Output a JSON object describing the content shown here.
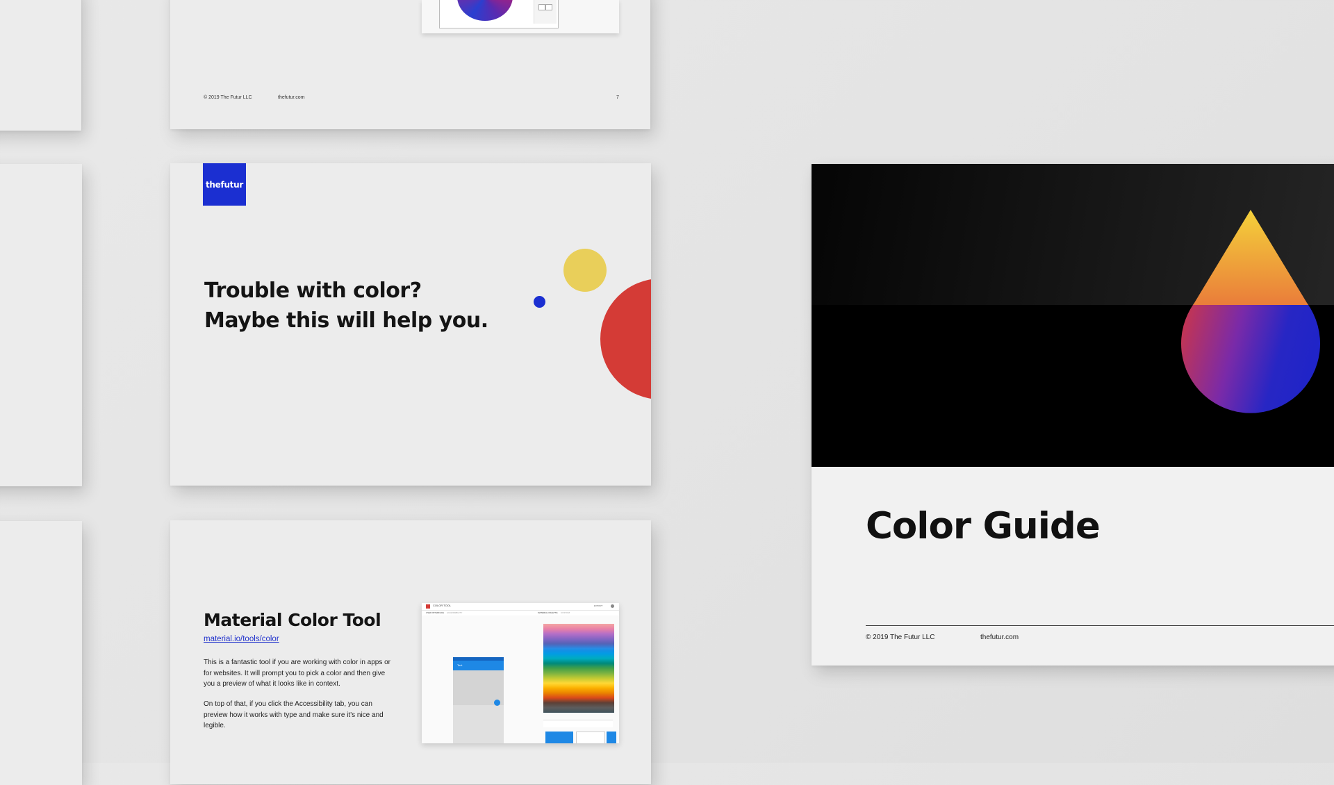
{
  "page_7": {
    "copyright": "© 2019 The Futur LLC",
    "site": "thefutur.com",
    "page_number": "7"
  },
  "trouble_page": {
    "logo_text": "thefutur",
    "headline_line1": "Trouble with color?",
    "headline_line2": "Maybe this will help you.",
    "colors": {
      "brand_blue": "#1b2fd1",
      "yellow": "#e9cf5a",
      "red": "#d43b36"
    }
  },
  "material_page": {
    "title": "Material Color Tool",
    "link": "material.io/tools/color",
    "paragraph1": "This is a fantastic tool if you are working with color in apps or for websites. It will prompt you to pick a color and then give you a preview of what it looks like in context.",
    "paragraph2": "On top of that, if you click the Accessibility tab, you can preview how it works with type and make sure it's nice and legible.",
    "screenshot": {
      "app_title": "COLOR TOOL",
      "tab_user_interface": "USER INTERFACE",
      "tab_accessibility": "ACCESSIBILITY",
      "tab_material_palette": "MATERIAL PALETTE",
      "tab_custom": "CUSTOM",
      "export_label": "EXPORT",
      "preview_text": "Text"
    }
  },
  "cover_page": {
    "title": "Color Guide",
    "copyright": "© 2019 The Futur LLC",
    "site": "thefutur.com"
  }
}
